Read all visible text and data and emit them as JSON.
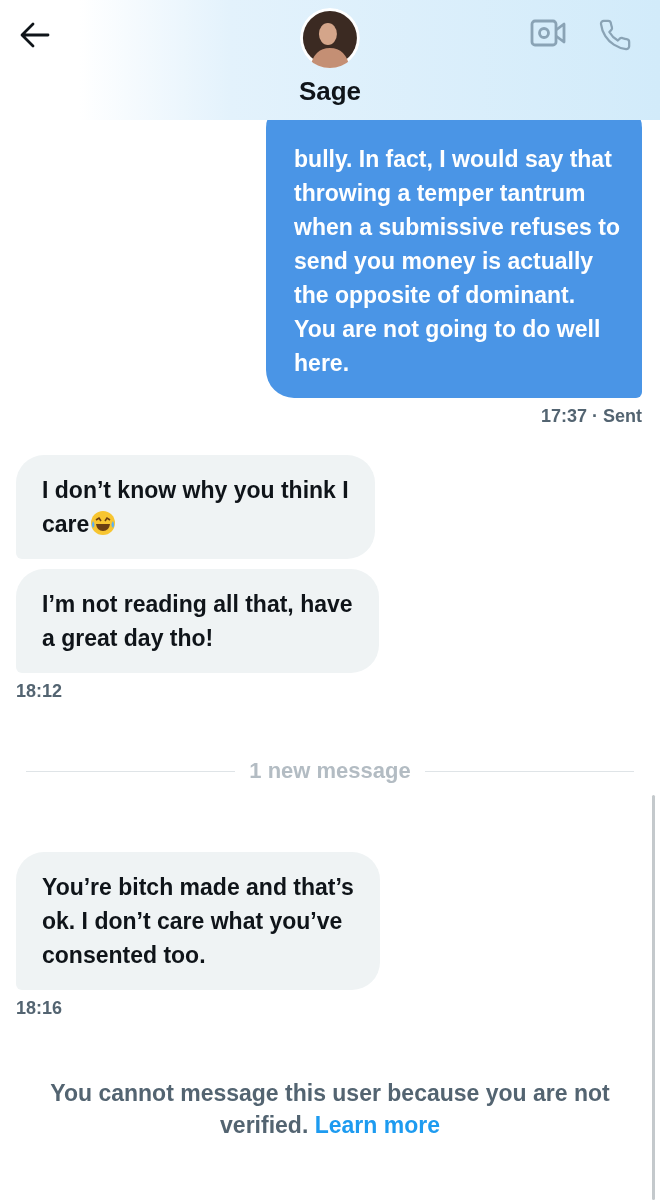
{
  "header": {
    "name": "Sage"
  },
  "messages": [
    {
      "kind": "sent",
      "lines": [
        "bully. In fact, I would say that\nthrowing a temper tantrum\nwhen a submissive refuses to\nsend you money is actually\nthe opposite of dominant.\nYou are not going to do well\nhere."
      ],
      "time": "17:37 · Sent"
    },
    {
      "kind": "received",
      "lines": [
        "I don’t know why you think I\ncare"
      ],
      "emoji": true
    },
    {
      "kind": "received",
      "lines": [
        "I’m not reading all that,  have\na great day tho!"
      ],
      "time": "18:12"
    },
    {
      "kind": "divider",
      "label": "1 new message"
    },
    {
      "kind": "received",
      "lines": [
        "You’re bitch made and that’s\nok. I don’t care what you’ve\nconsented too."
      ],
      "time": "18:16"
    }
  ],
  "notice": {
    "text": "You cannot message this user because you are not verified.",
    "link": "Learn more"
  }
}
